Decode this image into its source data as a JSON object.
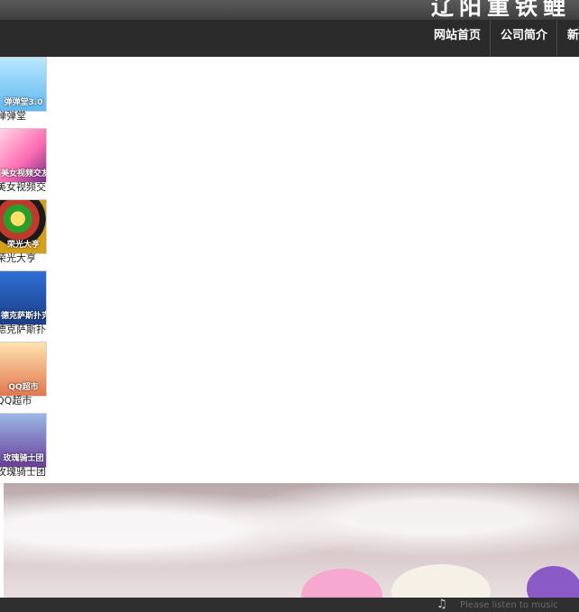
{
  "header": {
    "site_title": "辽阳重铁鲤"
  },
  "nav": {
    "items": [
      "网站首页",
      "公司简介",
      "新"
    ]
  },
  "games": [
    {
      "thumb_text": "弹弹堂3.0",
      "caption": "弹弹堂"
    },
    {
      "thumb_text": "美女视频交友",
      "caption": "美女视频交"
    },
    {
      "thumb_text": "荣光大亨",
      "caption": "荣光大亨"
    },
    {
      "thumb_text": "德克萨斯扑克",
      "caption": "德克萨斯扑"
    },
    {
      "thumb_text": "QQ超市",
      "caption": "QQ超市"
    },
    {
      "thumb_text": "玫瑰骑士团",
      "caption": "玫瑰骑士团"
    }
  ],
  "footer": {
    "music_icon": "music-note-icon",
    "text": "Please listen to music"
  }
}
